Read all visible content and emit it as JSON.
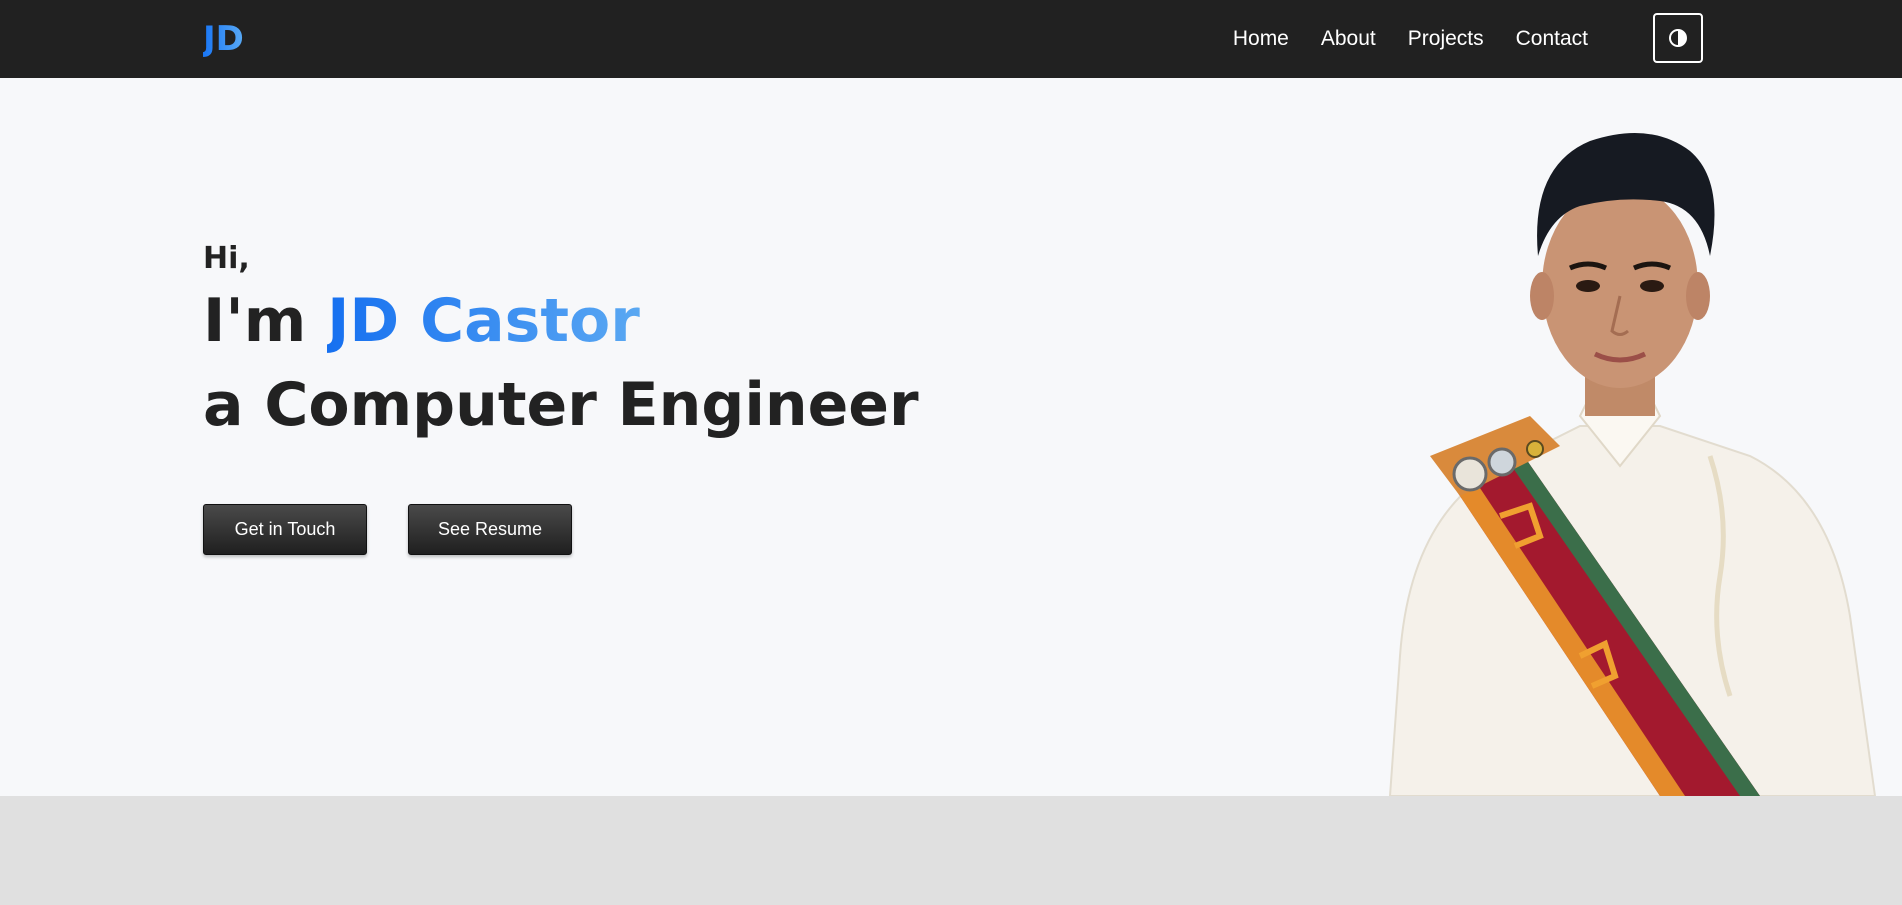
{
  "navbar": {
    "brand": "JD",
    "links": [
      {
        "label": "Home"
      },
      {
        "label": "About"
      },
      {
        "label": "Projects"
      },
      {
        "label": "Contact"
      }
    ],
    "theme_toggle_icon": "half-circle-contrast-icon"
  },
  "hero": {
    "greeting": "Hi,",
    "line1_prefix": "I'm ",
    "name": "JD Castor",
    "line2": "a Computer Engineer",
    "buttons": {
      "primary": "Get in Touch",
      "secondary": "See Resume"
    },
    "portrait_icon": "portrait-photo"
  },
  "colors": {
    "navbar_bg": "#212121",
    "accent_start": "#1670f0",
    "accent_end": "#5aa8f2",
    "hero_bg": "#f7f8fa",
    "footer_band": "#e0e0e0",
    "sash_red": "#a3192e",
    "sash_orange": "#e48a2a"
  }
}
